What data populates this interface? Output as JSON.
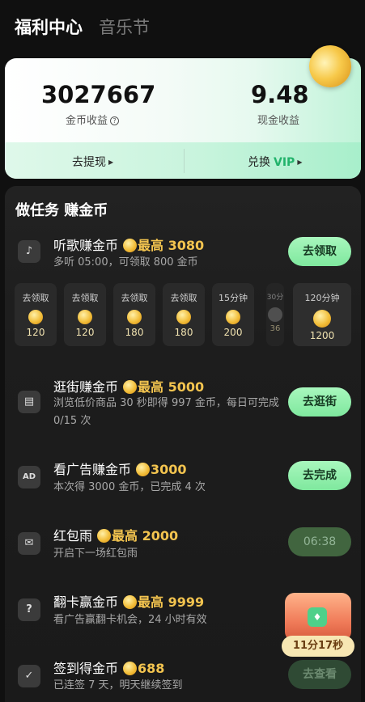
{
  "header": {
    "tab_active": "福利中心",
    "tab_inactive": "音乐节"
  },
  "earnings": {
    "coins_value": "3027667",
    "coins_label": "金币收益",
    "cash_value": "9.48",
    "cash_label": "现金收益",
    "withdraw_label": "去提现",
    "exchange_label": "兑换",
    "vip_label": "VIP"
  },
  "tasks_section": {
    "title": "做任务 赚金币"
  },
  "tasks": [
    {
      "title": "听歌赚金币",
      "reward": "最高 3080",
      "desc": "多听 05:00，可领取 800 金币",
      "button": "去领取",
      "icon": "music-icon"
    },
    {
      "title": "逛街赚金币",
      "reward": "最高 5000",
      "desc": "浏览低价商品 30 秒即得 997 金币，每日可完成 0/15 次",
      "button": "去逛街",
      "icon": "shopping-bag-icon"
    },
    {
      "title": "看广告赚金币",
      "reward": "3000",
      "desc": "本次得 3000 金币，已完成 4 次",
      "button": "去完成",
      "icon": "ad-icon"
    },
    {
      "title": "红包雨",
      "reward": "最高 2000",
      "desc": "开启下一场红包雨",
      "button": "06:38",
      "icon": "red-envelope-icon"
    },
    {
      "title": "翻卡赢金币",
      "reward": "最高 9999",
      "desc": "看广告赢翻卡机会，24 小时有效",
      "button": "",
      "icon": "card-flip-icon"
    },
    {
      "title": "签到得金币",
      "reward": "688",
      "desc": "已连签 7 天，明天继续签到",
      "button": "去查看",
      "icon": "check-in-icon"
    }
  ],
  "listen_slots": [
    {
      "label": "去领取",
      "amount": "120"
    },
    {
      "label": "去领取",
      "amount": "120"
    },
    {
      "label": "去领取",
      "amount": "180"
    },
    {
      "label": "去领取",
      "amount": "180"
    },
    {
      "label": "15分钟",
      "amount": "200"
    },
    {
      "label": "30分",
      "amount": "36"
    },
    {
      "label": "120分钟",
      "amount": "1200"
    }
  ],
  "chest": {
    "timer": "11分17秒"
  }
}
